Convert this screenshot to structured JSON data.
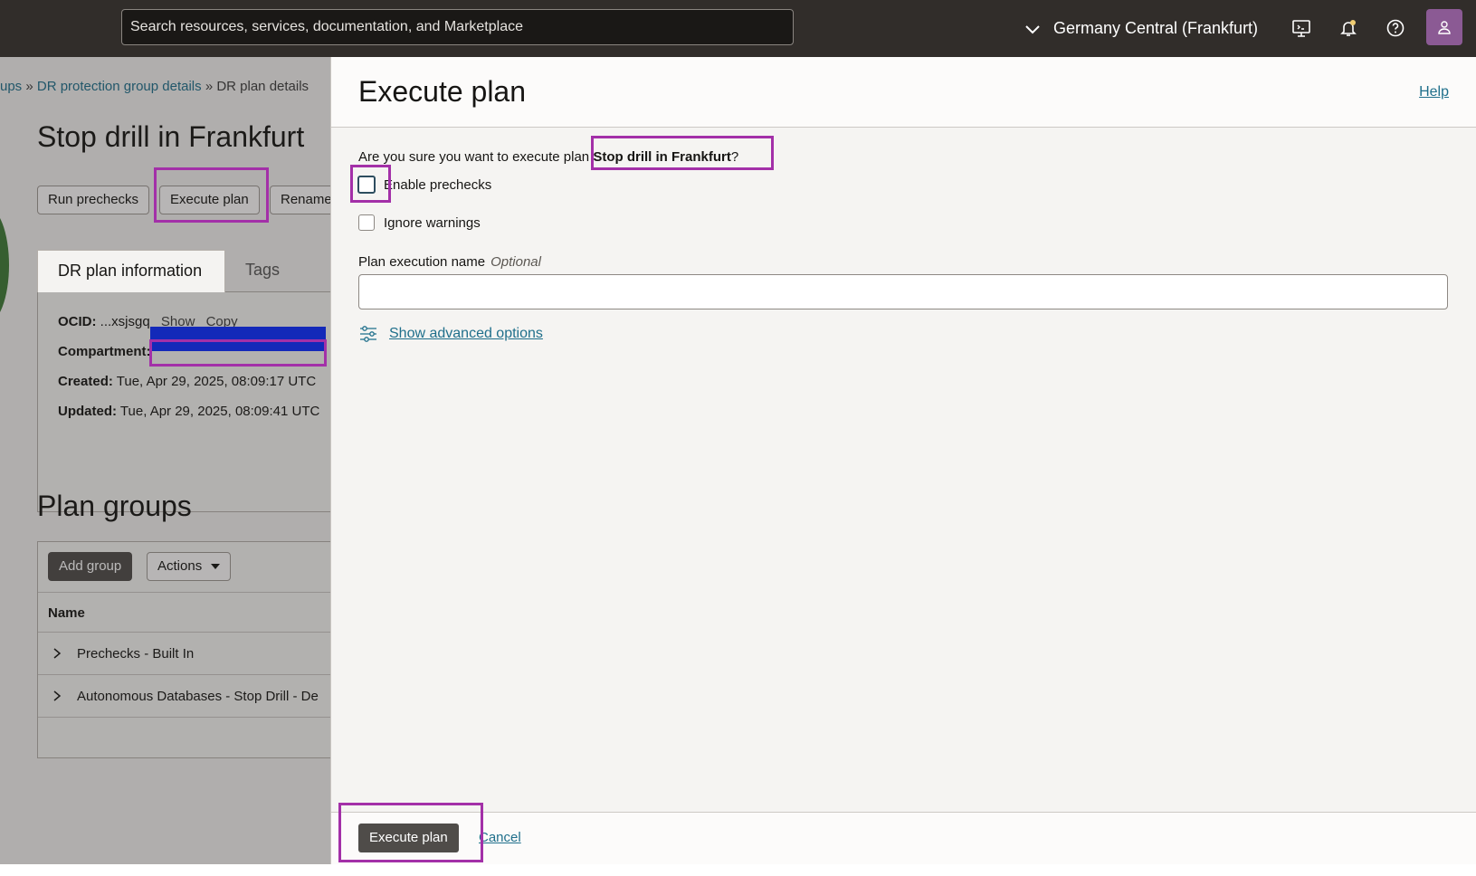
{
  "topbar": {
    "search_placeholder": "Search resources, services, documentation, and Marketplace",
    "region": "Germany Central (Frankfurt)",
    "icons": [
      "chevron-down-icon",
      "cloud-shell-icon",
      "bell-icon",
      "help-icon",
      "user-icon"
    ]
  },
  "background": {
    "breadcrumb": {
      "part1": "ups",
      "sep1": "»",
      "part2": "DR protection group details",
      "sep2": "»",
      "part3": "DR plan details"
    },
    "page_title": "Stop drill in Frankfurt",
    "buttons": {
      "run_prechecks": "Run prechecks",
      "execute_plan": "Execute plan",
      "rename": "Rename"
    },
    "tabs": {
      "active": "DR plan information",
      "tags": "Tags"
    },
    "info": {
      "ocid_label": "OCID:",
      "ocid_value": "...xsjsgq",
      "show": "Show",
      "copy": "Copy",
      "compartment_label": "Compartment:",
      "created_label": "Created:",
      "created_value": "Tue, Apr 29, 2025, 08:09:17 UTC",
      "updated_label": "Updated:",
      "updated_value": "Tue, Apr 29, 2025, 08:09:41 UTC"
    },
    "plan_groups": {
      "title": "Plan groups",
      "add_group": "Add group",
      "actions": "Actions",
      "column_name": "Name",
      "rows": [
        "Prechecks - Built In",
        "Autonomous Databases - Stop Drill - De"
      ]
    }
  },
  "drawer": {
    "title": "Execute plan",
    "help": "Help",
    "question_prefix": "Are you sure you want to execute plan",
    "plan_name": "Stop drill in Frankfurt",
    "question_suffix": "?",
    "enable_prechecks": "Enable prechecks",
    "ignore_warnings": "Ignore warnings",
    "execution_name_label": "Plan execution name",
    "optional": "Optional",
    "execution_name_value": "",
    "advanced_options": "Show advanced options",
    "execute_button": "Execute plan",
    "cancel": "Cancel"
  },
  "colors": {
    "topbar": "#312d2a",
    "link": "#1f6f8b",
    "primary_button": "#4f4c49",
    "highlight": "#a330a8",
    "redaction": "#0a2bff"
  }
}
